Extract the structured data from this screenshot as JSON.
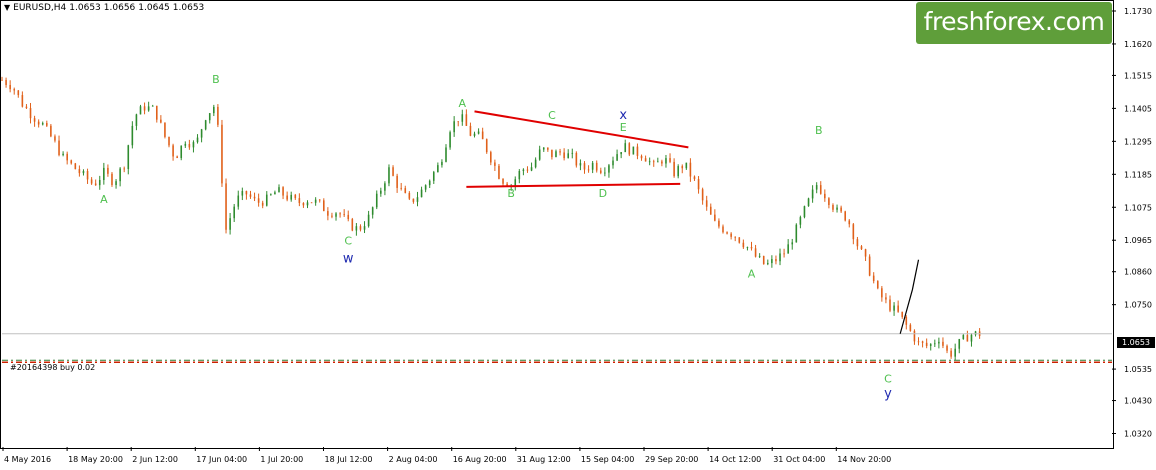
{
  "header": {
    "symbol": "EURUSD,H4",
    "open": "1.0653",
    "high": "1.0656",
    "low": "1.0645",
    "close": "1.0653"
  },
  "brand": "freshforex.com",
  "order_label": "#20164398 buy 0.02",
  "current_price_label": "1.0653",
  "colors": {
    "bull": "#2e8b2e",
    "bear": "#e0601a",
    "trendline": "#e00000",
    "order_line": "#cc2200",
    "wave_green": "#4fc04f",
    "wave_blue": "#1f2ab0",
    "brand_bg": "#5f9e3a"
  },
  "chart_data": {
    "type": "line",
    "symbol": "EURUSD",
    "timeframe": "H4",
    "ylim": [
      1.0275,
      1.176
    ],
    "y_ticks": [
      "1.1730",
      "1.1620",
      "1.1515",
      "1.1405",
      "1.1295",
      "1.1185",
      "1.1075",
      "1.0965",
      "1.0860",
      "1.0750",
      "1.0535",
      "1.0430",
      "1.0320"
    ],
    "x_ticks": [
      "4 May 2016",
      "18 May 20:00",
      "2 Jun 12:00",
      "17 Jun 04:00",
      "1 Jul 20:00",
      "18 Jul 12:00",
      "2 Aug 04:00",
      "16 Aug 20:00",
      "31 Aug 12:00",
      "15 Sep 04:00",
      "29 Sep 20:00",
      "14 Oct 12:00",
      "31 Oct 04:00",
      "14 Nov 20:00"
    ],
    "price_path": [
      [
        0,
        1.15
      ],
      [
        0.5,
        1.148
      ],
      [
        1,
        1.142
      ],
      [
        1.5,
        1.138
      ],
      [
        2,
        1.135
      ],
      [
        2.5,
        1.13
      ],
      [
        3,
        1.124
      ],
      [
        3.5,
        1.121
      ],
      [
        4,
        1.118
      ],
      [
        4.5,
        1.115
      ],
      [
        5,
        1.119
      ],
      [
        5.5,
        1.116
      ],
      [
        6,
        1.122
      ],
      [
        6.5,
        1.138
      ],
      [
        7,
        1.141
      ],
      [
        7.5,
        1.14
      ],
      [
        8,
        1.131
      ],
      [
        8.5,
        1.124
      ],
      [
        9,
        1.13
      ],
      [
        9.5,
        1.128
      ],
      [
        10,
        1.138
      ],
      [
        10.5,
        1.142
      ],
      [
        11,
        1.1
      ],
      [
        11.5,
        1.11
      ],
      [
        12,
        1.112
      ],
      [
        12.5,
        1.109
      ],
      [
        13,
        1.11
      ],
      [
        13.5,
        1.113
      ],
      [
        14,
        1.111
      ],
      [
        14.5,
        1.109
      ],
      [
        15,
        1.11
      ],
      [
        15.5,
        1.109
      ],
      [
        16,
        1.106
      ],
      [
        16.5,
        1.106
      ],
      [
        17,
        1.102
      ],
      [
        17.5,
        1.1
      ],
      [
        18,
        1.104
      ],
      [
        18.5,
        1.112
      ],
      [
        19,
        1.12
      ],
      [
        19.5,
        1.114
      ],
      [
        20,
        1.109
      ],
      [
        20.5,
        1.112
      ],
      [
        21,
        1.117
      ],
      [
        21.5,
        1.122
      ],
      [
        22,
        1.134
      ],
      [
        22.5,
        1.138
      ],
      [
        23,
        1.132
      ],
      [
        23.5,
        1.131
      ],
      [
        24,
        1.124
      ],
      [
        24.5,
        1.117
      ],
      [
        25,
        1.115
      ],
      [
        25.5,
        1.12
      ],
      [
        26,
        1.121
      ],
      [
        26.5,
        1.127
      ],
      [
        27,
        1.125
      ],
      [
        27.5,
        1.126
      ],
      [
        28,
        1.124
      ],
      [
        28.5,
        1.12
      ],
      [
        29,
        1.122
      ],
      [
        29.5,
        1.12
      ],
      [
        30,
        1.124
      ],
      [
        30.5,
        1.128
      ],
      [
        31,
        1.126
      ],
      [
        31.5,
        1.125
      ],
      [
        32,
        1.121
      ],
      [
        32.5,
        1.124
      ],
      [
        33,
        1.119
      ],
      [
        33.5,
        1.122
      ],
      [
        34,
        1.116
      ],
      [
        34.5,
        1.108
      ],
      [
        35,
        1.102
      ],
      [
        35.5,
        1.1
      ],
      [
        36,
        1.098
      ],
      [
        36.5,
        1.095
      ],
      [
        37,
        1.091
      ],
      [
        37.5,
        1.088
      ],
      [
        38,
        1.09
      ],
      [
        38.5,
        1.093
      ],
      [
        39,
        1.1
      ],
      [
        39.5,
        1.108
      ],
      [
        40,
        1.115
      ],
      [
        40.5,
        1.111
      ],
      [
        41,
        1.106
      ],
      [
        41.5,
        1.104
      ],
      [
        42,
        1.095
      ],
      [
        42.5,
        1.088
      ],
      [
        43,
        1.079
      ],
      [
        43.5,
        1.075
      ],
      [
        44,
        1.072
      ],
      [
        44.5,
        1.067
      ],
      [
        45,
        1.062
      ],
      [
        45.5,
        1.061
      ],
      [
        46,
        1.064
      ],
      [
        46.5,
        1.058
      ],
      [
        47,
        1.062
      ],
      [
        47.5,
        1.065
      ],
      [
        48,
        1.0653
      ]
    ],
    "annotations": [
      {
        "text": "A",
        "x": 5.0,
        "y": 1.109,
        "color": "green"
      },
      {
        "text": "B",
        "x": 10.5,
        "y": 1.149,
        "color": "green"
      },
      {
        "text": "C",
        "x": 17.0,
        "y": 1.095,
        "color": "green"
      },
      {
        "text": "w",
        "x": 17.0,
        "y": 1.089,
        "color": "blue"
      },
      {
        "text": "A",
        "x": 22.6,
        "y": 1.141,
        "color": "green"
      },
      {
        "text": "B",
        "x": 25.0,
        "y": 1.111,
        "color": "green"
      },
      {
        "text": "C",
        "x": 27.0,
        "y": 1.137,
        "color": "green"
      },
      {
        "text": "x",
        "x": 30.5,
        "y": 1.137,
        "color": "blue"
      },
      {
        "text": "E",
        "x": 30.5,
        "y": 1.133,
        "color": "green"
      },
      {
        "text": "D",
        "x": 29.5,
        "y": 1.111,
        "color": "green"
      },
      {
        "text": "A",
        "x": 36.8,
        "y": 1.084,
        "color": "green"
      },
      {
        "text": "B",
        "x": 40.1,
        "y": 1.132,
        "color": "green"
      },
      {
        "text": "C",
        "x": 43.5,
        "y": 1.049,
        "color": "green"
      },
      {
        "text": "y",
        "x": 43.5,
        "y": 1.044,
        "color": "blue"
      }
    ],
    "trendlines": [
      {
        "from": [
          23.2,
          1.1395
        ],
        "to": [
          33.7,
          1.1275
        ]
      },
      {
        "from": [
          22.8,
          1.1143
        ],
        "to": [
          33.3,
          1.1153
        ]
      }
    ],
    "forecast_path": [
      [
        44.1,
        1.0653
      ],
      [
        44.7,
        1.08
      ],
      [
        45.0,
        1.09
      ]
    ],
    "order_level": 1.0558,
    "current_price": 1.0653,
    "x_max": 54.5
  }
}
